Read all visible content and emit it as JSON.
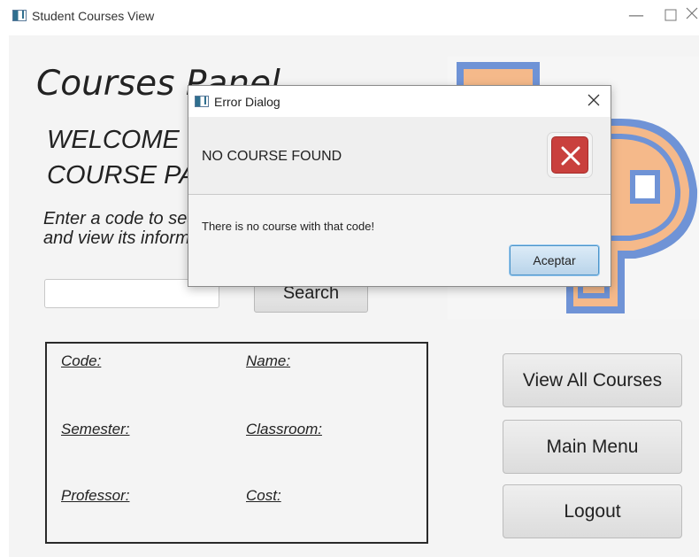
{
  "window": {
    "title": "Student Courses View",
    "minimize_icon": "minimize-icon",
    "maximize_icon": "maximize-icon",
    "close_icon": "close-icon"
  },
  "panel": {
    "title": "Courses Panel",
    "welcome_line1": "WELCOME TO THE",
    "welcome_line2": "COURSE PANEL",
    "instructions_line1": "Enter a code to search a course",
    "instructions_line2": "and view its information",
    "code_input_value": "",
    "search_label": "Search"
  },
  "logo": {
    "letter": "P",
    "colors": {
      "fill": "#f5b98a",
      "outline": "#6f93d6"
    }
  },
  "info": {
    "code_label": "Code:",
    "name_label": "Name:",
    "semester_label": "Semester:",
    "classroom_label": "Classroom:",
    "professor_label": "Professor:",
    "cost_label": "Cost:"
  },
  "actions": {
    "view_all_label": "View All Courses",
    "main_menu_label": "Main Menu",
    "logout_label": "Logout"
  },
  "dialog": {
    "title": "Error Dialog",
    "header": "NO COURSE FOUND",
    "content": "There is no course with that code!",
    "accept_label": "Aceptar",
    "icon": "error-icon",
    "colors": {
      "error": "#c9403d",
      "default_button_border": "#4b94c9"
    }
  }
}
